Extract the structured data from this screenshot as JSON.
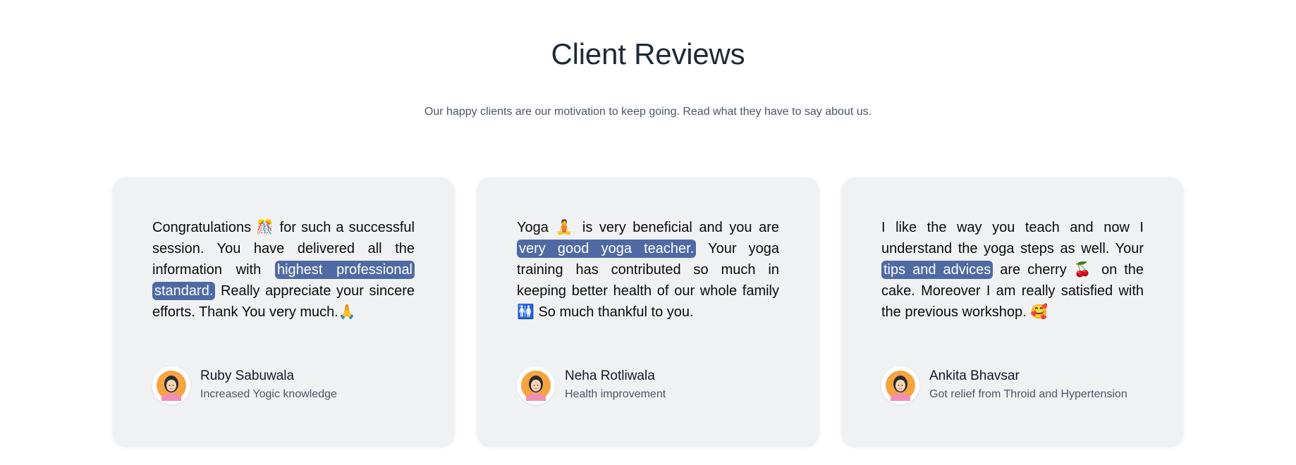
{
  "header": {
    "title": "Client Reviews",
    "subtitle": "Our happy clients are our motivation to keep going. Read what they have to say about us."
  },
  "colors": {
    "card_bg": "#f0f1f3",
    "highlight_bg": "#4f6aa3",
    "avatar_orange": "#f5a442",
    "avatar_pink": "#f08fb3"
  },
  "reviews": [
    {
      "pre": "Congratulations 🎊 for such a successful session. You have delivered all the information with ",
      "highlight": "highest professional standard.",
      "post": " Really appreciate your sincere efforts. Thank You very much.🙏",
      "name": "Ruby Sabuwala",
      "role": "Increased Yogic knowledge",
      "avatar_icon": "woman-avatar-icon"
    },
    {
      "pre": "Yoga 🧘 is very beneficial and you are ",
      "highlight": "very good yoga teacher.",
      "post": " Your yoga training has contributed so much in keeping better health of our whole family 🚻 So much thankful to you.",
      "name": "Neha Rotliwala",
      "role": "Health improvement",
      "avatar_icon": "woman-avatar-icon"
    },
    {
      "pre": "I like the way you teach and now I understand the yoga steps as well. Your ",
      "highlight": "tips and advices",
      "post": " are cherry 🍒 on the cake. Moreover I am really satisfied with the previous workshop. 🥰",
      "name": "Ankita Bhavsar",
      "role": "Got relief from Throid and Hypertension",
      "avatar_icon": "woman-avatar-icon"
    }
  ]
}
